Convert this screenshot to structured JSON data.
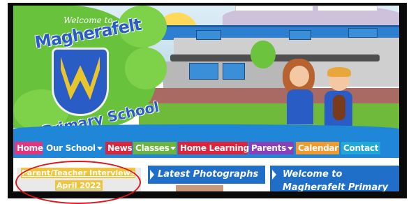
{
  "header": {
    "welcome_text": "Welcome to",
    "school_name_line1": "Magherafelt",
    "school_name_line2": "Primary School"
  },
  "nav": {
    "items": [
      {
        "label": "Home",
        "color": "#e8337c",
        "has_dropdown": false
      },
      {
        "label": "Our School",
        "color": "#1f86d8",
        "has_dropdown": true
      },
      {
        "label": "News",
        "color": "#e0213a",
        "has_dropdown": false
      },
      {
        "label": "Classes",
        "color": "#6cb33f",
        "has_dropdown": true
      },
      {
        "label": "Home Learning",
        "color": "#e0213a",
        "has_dropdown": false
      },
      {
        "label": "Parents",
        "color": "#8a3fb8",
        "has_dropdown": true
      },
      {
        "label": "Calendar",
        "color": "#f59a2a",
        "has_dropdown": false
      },
      {
        "label": "Contact",
        "color": "#20a9d8",
        "has_dropdown": false
      }
    ]
  },
  "content": {
    "left_link": {
      "line1": "Parent/Teacher Interviews",
      "line2": "April 2022",
      "color": "#efc53f"
    },
    "middle_panel": {
      "heading": "Latest Photographs"
    },
    "right_panel": {
      "line1": "Welcome to",
      "line2": "Magherafelt Primary"
    }
  },
  "colors": {
    "nav_background": "#1f86d8",
    "panel_blue": "#1f6fc8",
    "annotation_red": "#e0161a",
    "frame": "#0a0a0a"
  }
}
